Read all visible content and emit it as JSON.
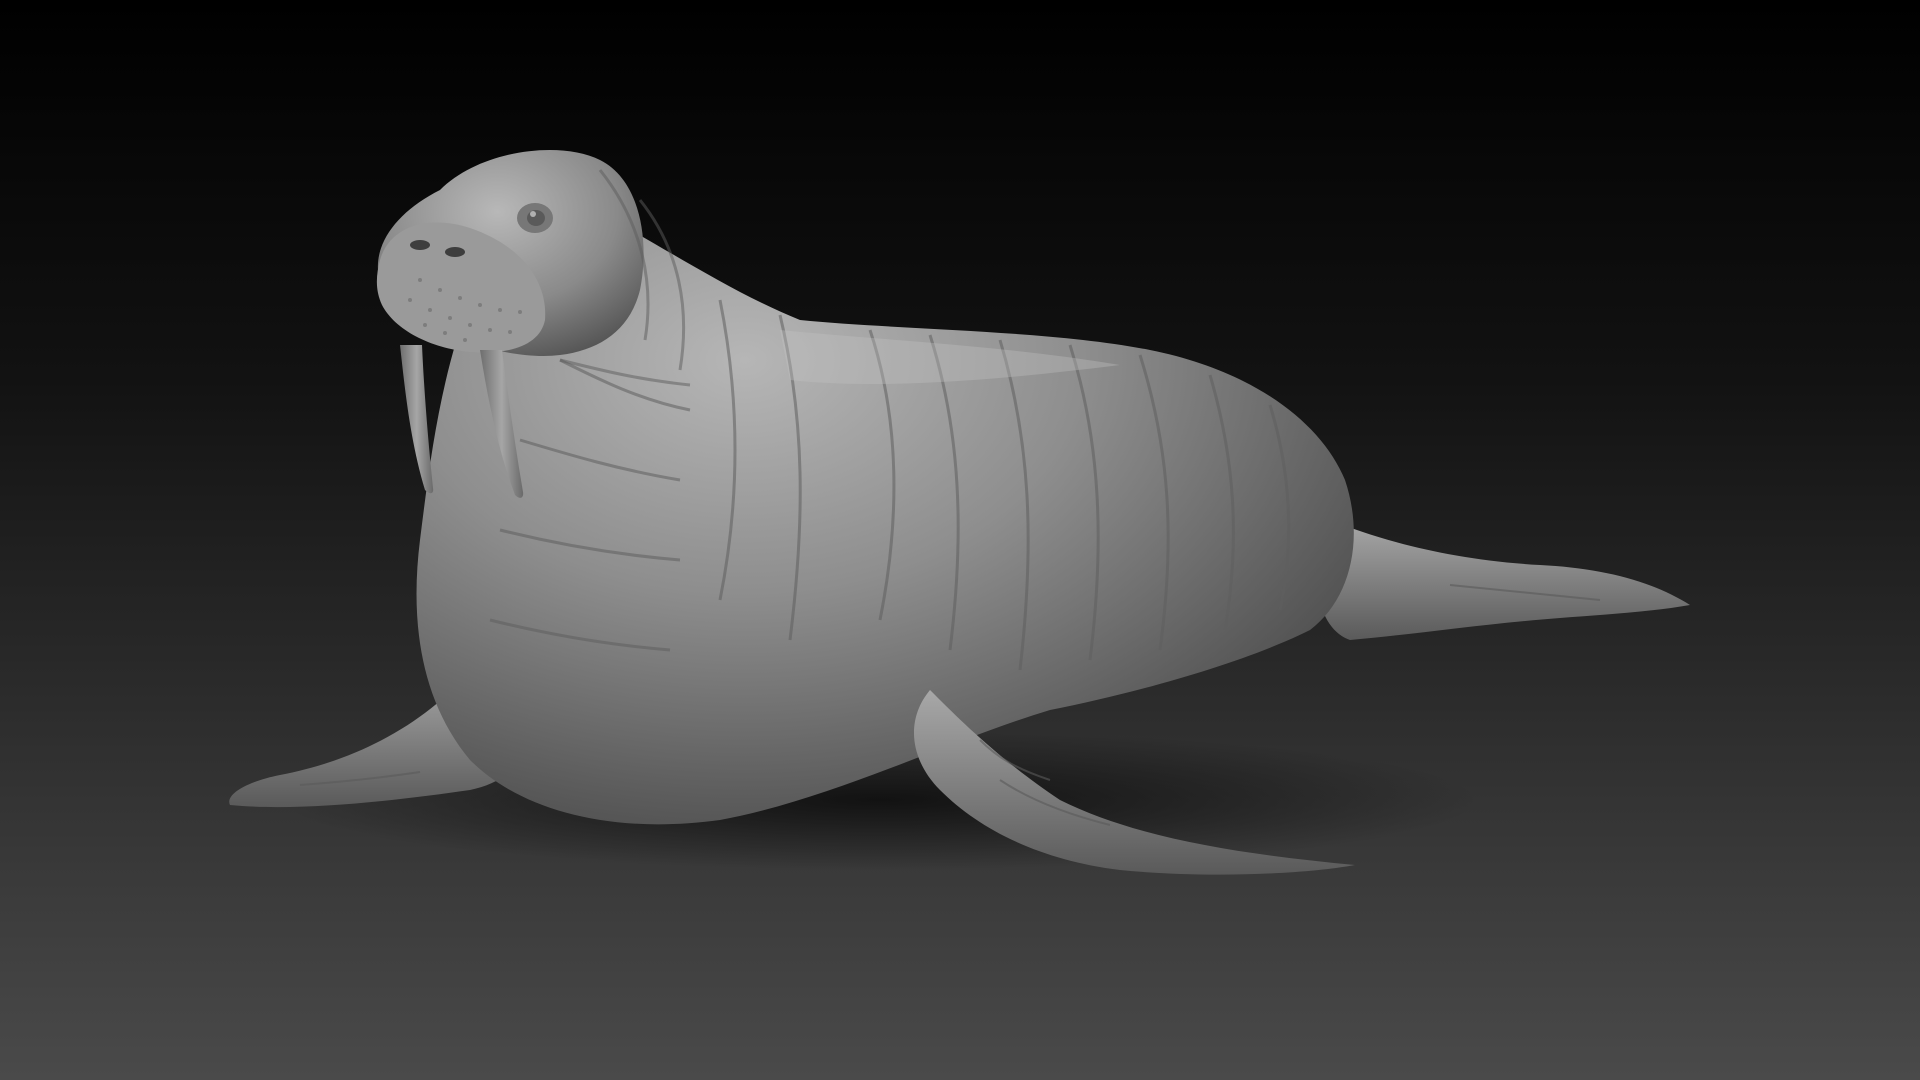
{
  "scene": {
    "subject": "walrus-sculpt",
    "colors": {
      "background_top": "#000000",
      "background_bottom": "#4a4a4a",
      "clay_light": "#b4b4b4",
      "clay_mid": "#8c8c8c",
      "clay_dark": "#4c4c4c",
      "shadow": "#161616"
    }
  }
}
